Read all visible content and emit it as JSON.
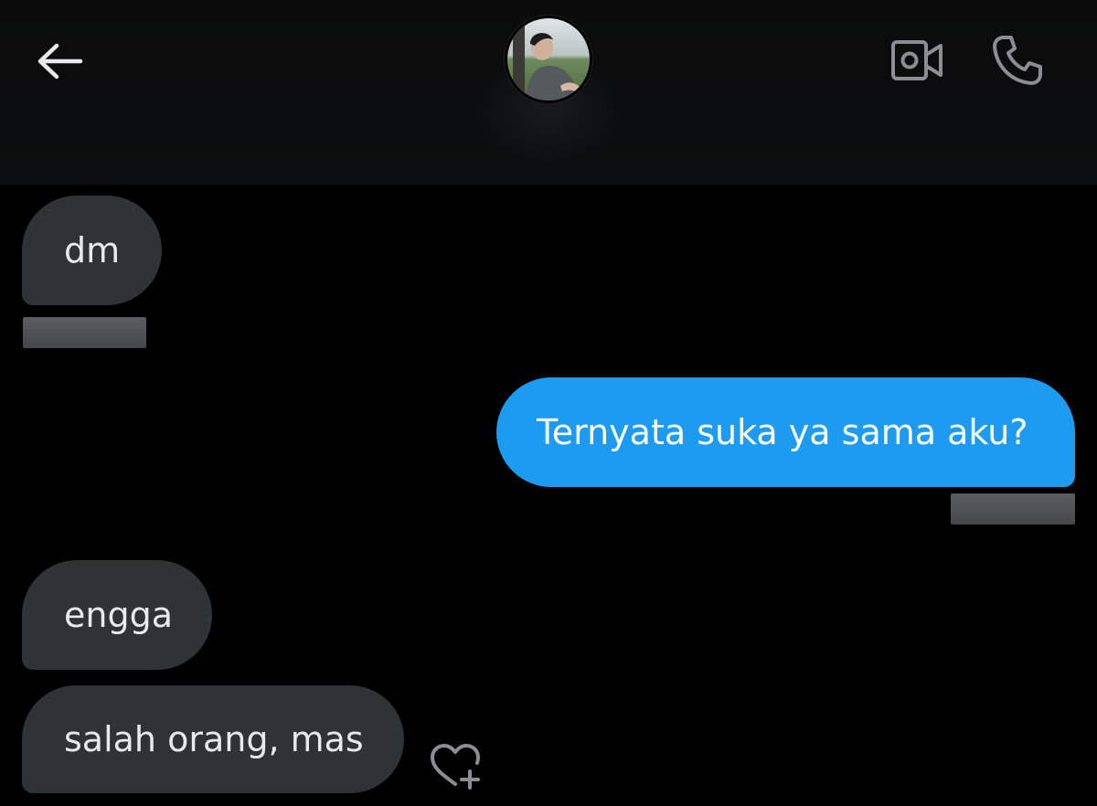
{
  "header": {
    "back_icon": "arrow-left-icon",
    "avatar_alt": "avatar",
    "video_icon": "video-camera-icon",
    "call_icon": "phone-icon"
  },
  "messages": [
    {
      "direction": "received",
      "text": "dm",
      "meta_redacted": true
    },
    {
      "direction": "sent",
      "text": "Ternyata suka ya sama aku?",
      "meta_redacted": true
    },
    {
      "direction": "received",
      "text": "engga"
    },
    {
      "direction": "received",
      "text": "salah orang, mas"
    }
  ],
  "reaction": {
    "icon": "heart-plus-icon"
  },
  "colors": {
    "background": "#000000",
    "received_bubble": "#2f3336",
    "sent_bubble": "#1d9bf0",
    "icon": "#8b8f94"
  }
}
